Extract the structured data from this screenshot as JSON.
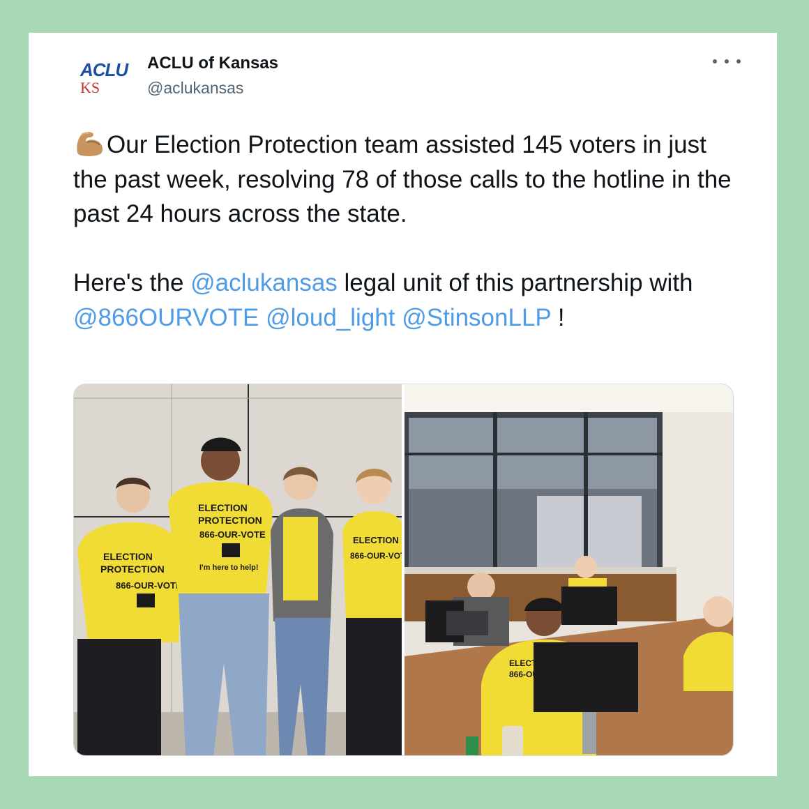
{
  "tweet": {
    "logo_primary": "ACLU",
    "logo_secondary": "KS",
    "display_name": "ACLU of Kansas",
    "handle": "@aclukansas",
    "emoji_icon": "flexed-biceps-icon",
    "body_line1": "Our Election Protection team assisted 145 voters in just the past week, resolving 78 of those calls to the hotline in the past 24 hours across the state.",
    "body_p2_prefix": "Here's the ",
    "mention_1": "@aclukansas",
    "body_p2_mid": " legal unit of this partnership with ",
    "mention_2": "@866OURVOTE",
    "mention_3": "@loud_light",
    "mention_4": "@StinsonLLP",
    "body_p2_suffix": " !"
  },
  "media": {
    "shirt_line1": "ELECTION",
    "shirt_line2": "PROTECTION",
    "shirt_line3": "866-OUR-VOTE",
    "shirt_line4": "I'm here to help!"
  },
  "colors": {
    "frame": "#a8d8b6",
    "mention": "#4f9ce6",
    "shirt": "#f4e03a",
    "aclu_blue": "#1b4fa3",
    "ks_red": "#c8312c"
  }
}
